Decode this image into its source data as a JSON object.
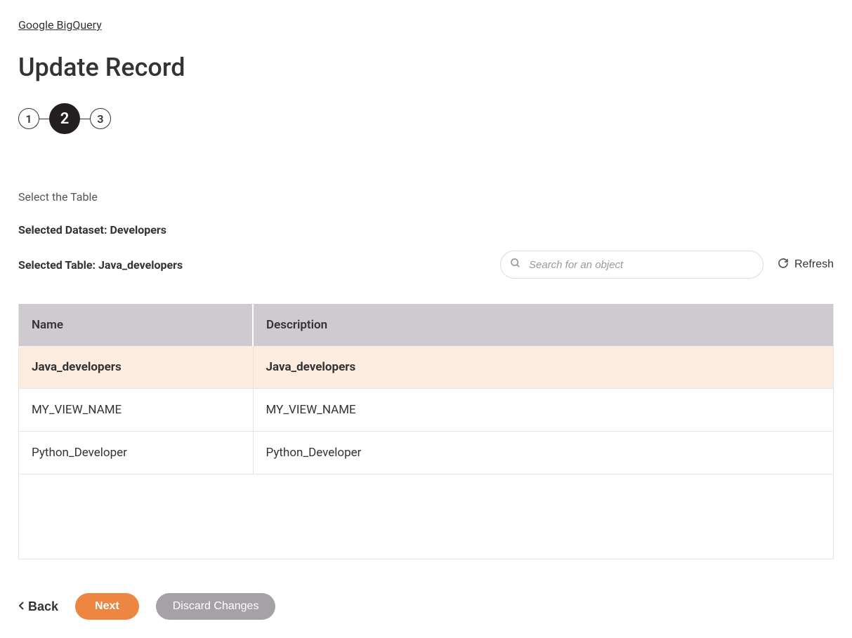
{
  "breadcrumb": {
    "label": "Google BigQuery"
  },
  "page": {
    "title": "Update Record"
  },
  "stepper": {
    "steps": [
      "1",
      "2",
      "3"
    ],
    "active_index": 1
  },
  "section": {
    "label": "Select the Table",
    "selected_dataset_label": "Selected Dataset: Developers",
    "selected_table_label": "Selected Table: Java_developers"
  },
  "search": {
    "placeholder": "Search for an object"
  },
  "refresh": {
    "label": "Refresh"
  },
  "table": {
    "headers": {
      "name": "Name",
      "description": "Description"
    },
    "rows": [
      {
        "name": "Java_developers",
        "description": "Java_developers",
        "selected": true
      },
      {
        "name": "MY_VIEW_NAME",
        "description": "MY_VIEW_NAME",
        "selected": false
      },
      {
        "name": "Python_Developer",
        "description": "Python_Developer",
        "selected": false
      }
    ]
  },
  "footer": {
    "back": "Back",
    "next": "Next",
    "discard": "Discard Changes"
  }
}
